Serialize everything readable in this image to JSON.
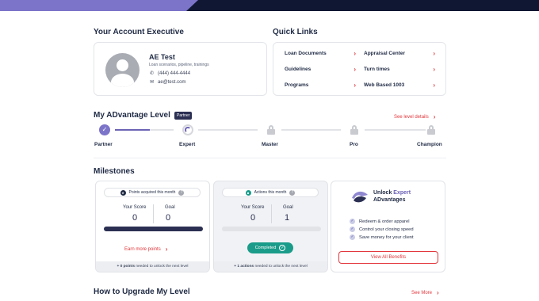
{
  "colors": {
    "accent": "#e2373c",
    "brand_navy": "#2b2f52",
    "purple": "#6c63b5",
    "teal": "#1b9c8a"
  },
  "account_executive": {
    "section_title": "Your Account Executive",
    "name": "AE Test",
    "subtitle": "Loan scenarios, pipeline, trainings",
    "phone": "(444) 444-4444",
    "email": "ae@test.com"
  },
  "quick_links": {
    "section_title": "Quick Links",
    "items": [
      {
        "label": "Loan Documents"
      },
      {
        "label": "Appraisal Center"
      },
      {
        "label": "Guidelines"
      },
      {
        "label": "Turn times"
      },
      {
        "label": "Programs"
      },
      {
        "label": "Web Based 1003"
      }
    ]
  },
  "level": {
    "section_title": "My ADvantage Level",
    "badge": "Partner",
    "see_details": "See level details",
    "levels": [
      {
        "label": "Partner",
        "state": "done"
      },
      {
        "label": "Expert",
        "state": "current"
      },
      {
        "label": "Master",
        "state": "locked"
      },
      {
        "label": "Pro",
        "state": "locked"
      },
      {
        "label": "Champion",
        "state": "locked"
      }
    ],
    "progress_to_next": 0.6
  },
  "milestones": {
    "section_title": "Milestones",
    "points": {
      "title": "Points acquired this month",
      "score_label": "Your Score",
      "score": "0",
      "goal_label": "Goal",
      "goal": "0",
      "progress": 1.0,
      "earn_label": "Earn more points",
      "footer_bold": "+ 0 points",
      "footer_rest": " needed to unlock the next level"
    },
    "actions": {
      "title": "Actions this month",
      "score_label": "Your Score",
      "score": "0",
      "goal_label": "Goal",
      "goal": "1",
      "progress": 0,
      "completed_label": "Completed",
      "footer_bold": "+ 1 actions",
      "footer_rest": " needed to unlock the next level"
    },
    "unlock": {
      "title_prefix": "Unlock ",
      "title_accent": "Expert",
      "title_line2": "ADvantages",
      "benefits": [
        "Redeem & order apparel",
        "Control your closing speed",
        "Save money for your client"
      ],
      "button": "View All Benefits"
    }
  },
  "upgrade": {
    "section_title": "How to Upgrade My Level",
    "see_more": "See More"
  }
}
